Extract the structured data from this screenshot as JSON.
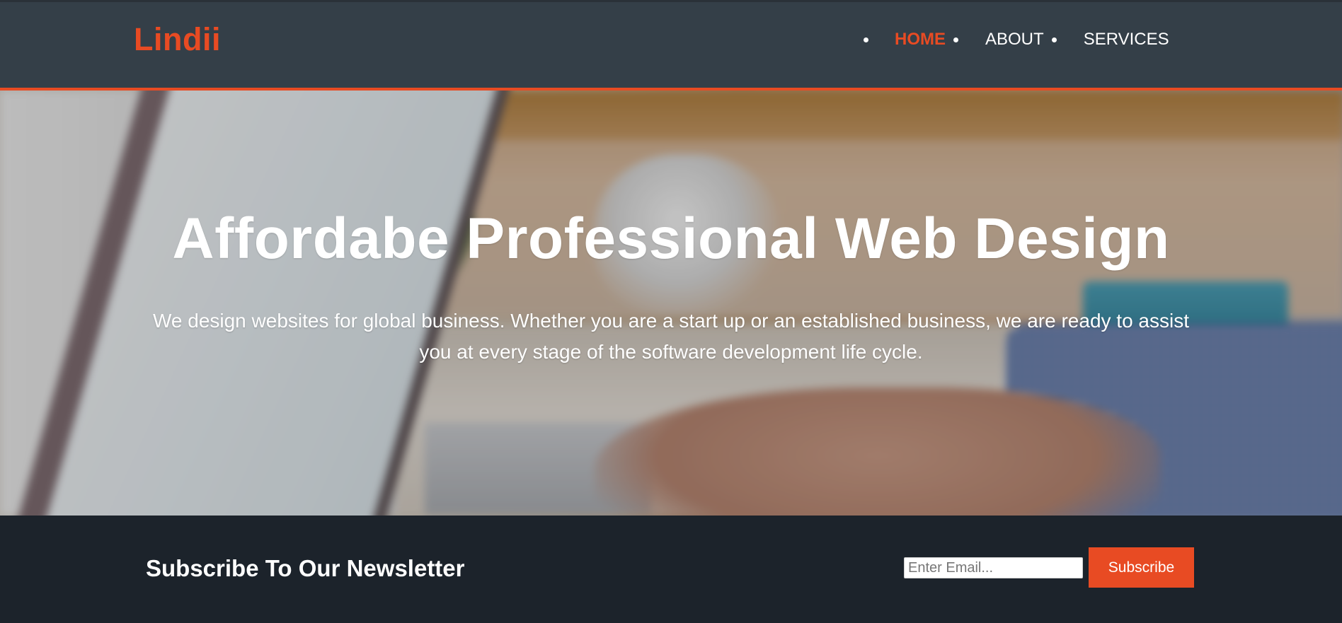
{
  "brand": {
    "logo": "Lindii",
    "accent_color": "#e84b23"
  },
  "nav": {
    "items": [
      {
        "label": "HOME",
        "active": true
      },
      {
        "label": "ABOUT",
        "active": false
      },
      {
        "label": "SERVICES",
        "active": false
      }
    ]
  },
  "hero": {
    "title": "Affordabe Professional Web Design",
    "text": "We design websites for global business. Whether you are a start up or an established business, we are ready to assist you at every stage of the software development life cycle."
  },
  "newsletter": {
    "title": "Subscribe To Our Newsletter",
    "email_placeholder": "Enter Email...",
    "email_value": "",
    "button_label": "Subscribe"
  },
  "colors": {
    "header_bg": "#343f48",
    "footer_bg": "#1c232b"
  }
}
